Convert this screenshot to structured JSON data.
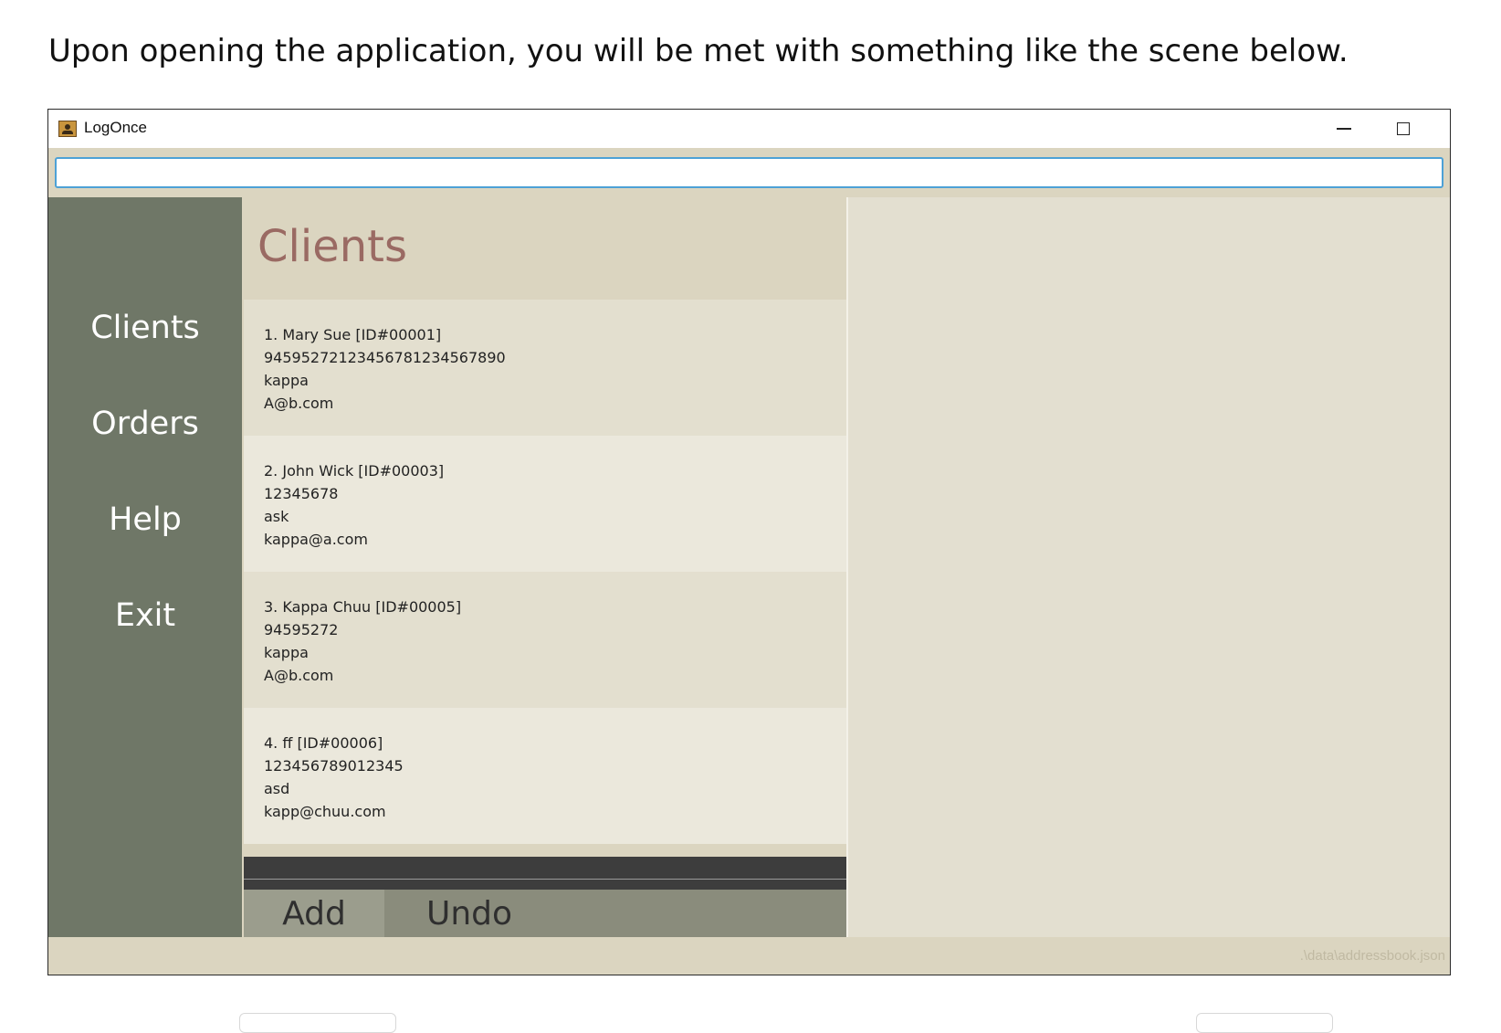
{
  "intro_text": "Upon opening the application, you will be met with something like the scene below.",
  "window": {
    "title": "LogOnce",
    "icon": "address-book-icon",
    "controls": {
      "minimize": "minimize-icon",
      "maximize": "maximize-icon",
      "close": "close-icon"
    }
  },
  "command_box": {
    "value": "",
    "placeholder": ""
  },
  "sidebar": {
    "items": [
      {
        "label": "Clients"
      },
      {
        "label": "Orders"
      },
      {
        "label": "Help"
      },
      {
        "label": "Exit"
      }
    ]
  },
  "list_panel": {
    "title": "Clients",
    "clients": [
      {
        "header": "1.  Mary Sue [ID#00001]",
        "phone": "94595272123456781234567890",
        "address": "kappa",
        "email": "A@b.com"
      },
      {
        "header": "2.  John Wick [ID#00003]",
        "phone": "12345678",
        "address": "ask",
        "email": "kappa@a.com"
      },
      {
        "header": "3.  Kappa Chuu [ID#00005]",
        "phone": "94595272",
        "address": "kappa",
        "email": "A@b.com"
      },
      {
        "header": "4.  ff [ID#00006]",
        "phone": "123456789012345",
        "address": "asd",
        "email": "kapp@chuu.com"
      }
    ],
    "actions": {
      "add": "Add",
      "undo": "Undo"
    }
  },
  "status_bar": {
    "file_path": ".\\data\\addressbook.json"
  },
  "colors": {
    "sidebar": "#6f7767",
    "title_accent": "#9a6a63",
    "input_focus": "#4da1d6",
    "background": "#dbd5c0"
  }
}
